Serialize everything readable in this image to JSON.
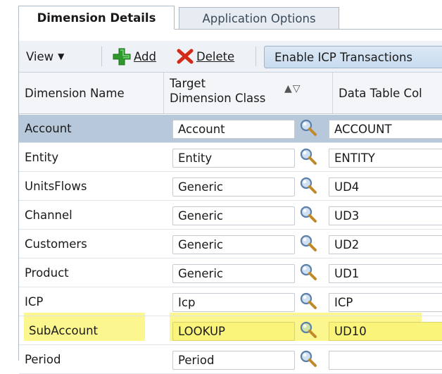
{
  "tabs": [
    {
      "label": "Dimension Details",
      "active": true
    },
    {
      "label": "Application Options",
      "active": false
    }
  ],
  "toolbar": {
    "view_label": "View",
    "add_label": "Add",
    "delete_label": "Delete",
    "icp_button_label": "Enable ICP Transactions"
  },
  "columns": {
    "name": "Dimension Name",
    "class_line1": "Target",
    "class_line2": "Dimension Class",
    "column": "Data Table Col"
  },
  "rows": [
    {
      "name": "Account",
      "class": "Account",
      "column": "ACCOUNT",
      "selected": true
    },
    {
      "name": "Entity",
      "class": "Entity",
      "column": "ENTITY"
    },
    {
      "name": "UnitsFlows",
      "class": "Generic",
      "column": "UD4"
    },
    {
      "name": "Channel",
      "class": "Generic",
      "column": "UD3"
    },
    {
      "name": "Customers",
      "class": "Generic",
      "column": "UD2"
    },
    {
      "name": "Product",
      "class": "Generic",
      "column": "UD1"
    },
    {
      "name": "ICP",
      "class": "Icp",
      "column": "ICP"
    },
    {
      "name": "SubAccount",
      "class": "LOOKUP",
      "column": "UD10",
      "highlighted": true
    },
    {
      "name": "Period",
      "class": "Period",
      "column": ""
    }
  ],
  "colors": {
    "selected_row": "#b8c8db",
    "highlight": "#faf57a",
    "add_icon": "#2e9a2e",
    "delete_icon": "#d42a1a"
  },
  "icons": {
    "view_caret": "chevron-down-icon",
    "add": "plus-icon",
    "delete": "x-icon",
    "lookup": "magnifier-icon",
    "sort": "sort-arrows-icon"
  }
}
